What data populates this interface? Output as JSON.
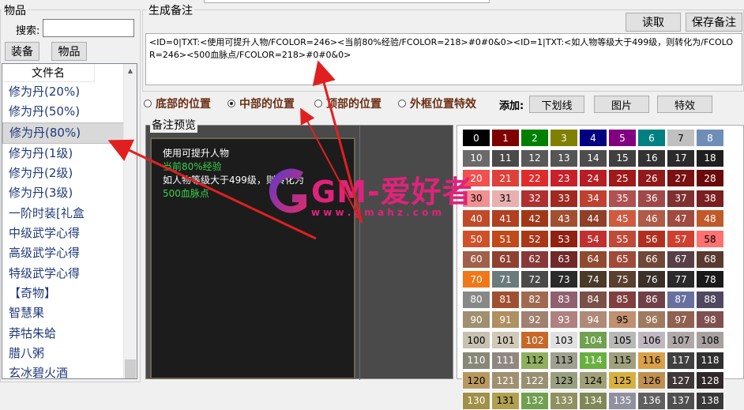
{
  "left": {
    "group_title": "物品",
    "search_label": "搜索:",
    "search_value": "",
    "btn_equip": "装备",
    "btn_item": "物品",
    "column_header": "文件名",
    "items": [
      "修为丹(20%)",
      "修为丹(50%)",
      "修为丹(80%)",
      "修为丹(1级)",
      "修为丹(2级)",
      "修为丹(3级)",
      "一阶时装[礼盒",
      "中级武学心得",
      "高级武学心得",
      "特级武学心得",
      "【奇物】",
      "智慧果",
      "莽牯朱蛤",
      "腊八粥",
      "玄冰碧火酒"
    ],
    "selected_index": 2
  },
  "note": {
    "group_title": "生成备注",
    "read_button": "读取",
    "save_button": "保存备注",
    "text": "<ID=0|TXT:<使用可提升人物/FCOLOR=246><当前80%经验/FCOLOR=218>#0#0&0><ID=1|TXT:<如人物等级大于499级，则转化为/FCOLOR=246><500血脉点/FCOLOR=218>#0#0&0>"
  },
  "position": {
    "options": [
      "底部的位置",
      "中部的位置",
      "顶部的位置",
      "外框位置特效"
    ],
    "selected_index": 1,
    "add_label": "添加:",
    "underline_button": "下划线",
    "image_button": "图片",
    "effect_button": "特效"
  },
  "preview": {
    "title": "备注预览",
    "lines": [
      {
        "text": "使用可提升人物",
        "color": "#ffffff"
      },
      {
        "text": "当前80%经验",
        "color": "#39d14a"
      },
      {
        "text": "如人物等级大于499级，则转化为",
        "color": "#ffffff"
      },
      {
        "text": "500血脉点",
        "color": "#39d14a"
      }
    ]
  },
  "palette": {
    "colors": [
      [
        "#000000",
        "#800000",
        "#008000",
        "#808000",
        "#000080",
        "#800080",
        "#008080",
        "#c0c0c0",
        "#6e8eb8"
      ],
      [
        "#6a6a6a",
        "#4a4a4a",
        "#595959",
        "#555555",
        "#4d4d4d",
        "#404040",
        "#333333",
        "#2b2b2b",
        "#1f1f1f"
      ],
      [
        "#f05050",
        "#e0403a",
        "#e02b2b",
        "#c8202a",
        "#b81c24",
        "#a01818",
        "#901a1a",
        "#7a1010",
        "#6b0a0a"
      ],
      [
        "#f09090",
        "#e8b0b0",
        "#b03030",
        "#a02a20",
        "#c04030",
        "#b05050",
        "#a04848",
        "#803030",
        "#7a2020"
      ],
      [
        "#c04a2a",
        "#b04020",
        "#a03818",
        "#a05030",
        "#904028",
        "#d05a40",
        "#b05a48",
        "#a04a40",
        "#c05a2a"
      ],
      [
        "#d0502a",
        "#c04a1a",
        "#a83818",
        "#902010",
        "#c03030",
        "#c04a38",
        "#b03020",
        "#d04030",
        "#ff7070"
      ],
      [
        "#a0604a",
        "#904030",
        "#883838",
        "#702828",
        "#904a30",
        "#a04a3a",
        "#704838",
        "#584048",
        "#5a3a30"
      ],
      [
        "#f07818",
        "#6b7a7a",
        "#4a4a4a",
        "#2a2a2a",
        "#4a3a2a",
        "#5a4030",
        "#3a3028",
        "#2a2a2a",
        "#1a1a1a"
      ],
      [
        "#888888",
        "#a05030",
        "#a06a50",
        "#906070",
        "#7a5048",
        "#804040",
        "#704048",
        "#6870a0",
        "#504860"
      ],
      [
        "#a09070",
        "#b09060",
        "#a08070",
        "#b08080",
        "#b08a78",
        "#c09070",
        "#a07a60",
        "#906050",
        "#805050"
      ],
      [
        "#c8c0b0",
        "#d0c8b8",
        "#c86828",
        "#e0e0e0",
        "#70a050",
        "#b8b8b8",
        "#c0b8c0",
        "#b0a8a8",
        "#a8a0a0"
      ],
      [
        "#888878",
        "#908880",
        "#90b060",
        "#a0a090",
        "#68b040",
        "#a0a080",
        "#d8a048",
        "#404040",
        "#303030"
      ],
      [
        "#b89860",
        "#a09070",
        "#989070",
        "#98a080",
        "#a0a078",
        "#d8b040",
        "#c09050",
        "#403838",
        "#302828"
      ],
      [
        "#a09048",
        "#b0a050",
        "#70a050",
        "#909060",
        "#808858",
        "#9090a0",
        "#606060",
        "#505050",
        "#383838"
      ]
    ],
    "start_number": 0
  },
  "watermark": {
    "text": "GM-爱好者",
    "url": "w w w . g m a h z . c o m"
  }
}
